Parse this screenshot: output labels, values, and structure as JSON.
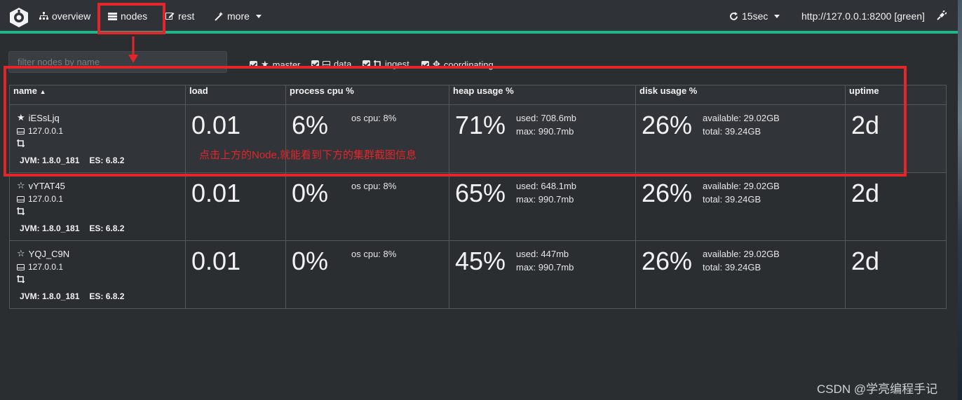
{
  "nav": {
    "overview": "overview",
    "nodes": "nodes",
    "rest": "rest",
    "more": "more",
    "refresh_interval": "15sec",
    "cluster_url": "http://127.0.0.1:8200 [green]"
  },
  "filter": {
    "placeholder": "filter nodes by name"
  },
  "roles": [
    "master",
    "data",
    "ingest",
    "coordinating"
  ],
  "table": {
    "headers": [
      "name",
      "load",
      "process cpu %",
      "heap usage %",
      "disk usage %",
      "uptime"
    ],
    "rows": [
      {
        "name": "iESsLjq",
        "master": true,
        "ip": "127.0.0.1",
        "jvm": "JVM: 1.8.0_181",
        "es": "ES: 6.8.2",
        "load": "0.01",
        "cpu": "6%",
        "os_cpu": "os cpu: 8%",
        "heap": "71%",
        "heap_used": "used: 708.6mb",
        "heap_max": "max: 990.7mb",
        "disk": "26%",
        "disk_available": "available: 29.02GB",
        "disk_total": "total: 39.24GB",
        "uptime": "2d"
      },
      {
        "name": "vYTAT45",
        "master": false,
        "ip": "127.0.0.1",
        "jvm": "JVM: 1.8.0_181",
        "es": "ES: 6.8.2",
        "load": "0.01",
        "cpu": "0%",
        "os_cpu": "os cpu: 8%",
        "heap": "65%",
        "heap_used": "used: 648.1mb",
        "heap_max": "max: 990.7mb",
        "disk": "26%",
        "disk_available": "available: 29.02GB",
        "disk_total": "total: 39.24GB",
        "uptime": "2d"
      },
      {
        "name": "YQJ_C9N",
        "master": false,
        "ip": "127.0.0.1",
        "jvm": "JVM: 1.8.0_181",
        "es": "ES: 6.8.2",
        "load": "0.01",
        "cpu": "0%",
        "os_cpu": "os cpu: 8%",
        "heap": "45%",
        "heap_used": "used: 447mb",
        "heap_max": "max: 990.7mb",
        "disk": "26%",
        "disk_available": "available: 29.02GB",
        "disk_total": "total: 39.24GB",
        "uptime": "2d"
      }
    ]
  },
  "annotation": "点击上方的Node,就能看到下方的集群截图信息",
  "watermark": "CSDN @学亮编程手记",
  "colors": {
    "accent": "#21b58a",
    "highlight": "#e3262b",
    "background": "#2b2e31"
  }
}
